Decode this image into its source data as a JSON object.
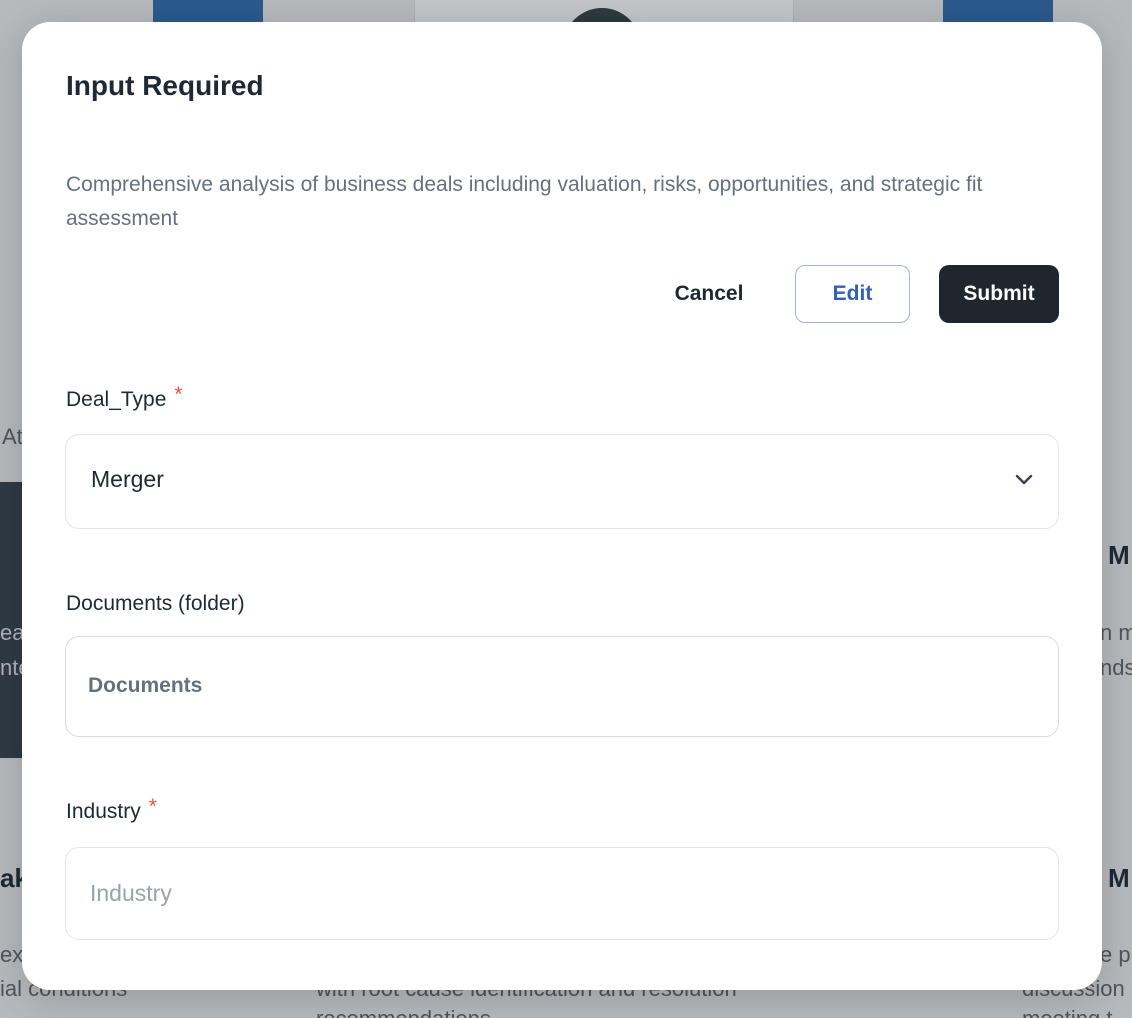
{
  "background": {
    "fragments": [
      "At",
      "M",
      "ea",
      "nte",
      "n m",
      "nds",
      "ak",
      "M",
      "ex",
      "ial conditions",
      "with root cause identification and resolution",
      "recommendations",
      "e p",
      "discussion",
      "meeting t"
    ]
  },
  "modal": {
    "title": "Input Required",
    "description": "Comprehensive analysis of business deals including valuation, risks, opportunities, and strategic fit assessment",
    "buttons": {
      "cancel": "Cancel",
      "edit": "Edit",
      "submit": "Submit"
    },
    "fields": {
      "deal_type": {
        "label": "Deal_Type",
        "required_mark": "*",
        "value": "Merger",
        "icon": "chevron-down-icon"
      },
      "documents": {
        "label": "Documents (folder)",
        "value": "Documents"
      },
      "industry": {
        "label": "Industry",
        "required_mark": "*",
        "value": "",
        "placeholder": "Industry"
      }
    }
  },
  "colors": {
    "primary_dark": "#1f262e",
    "edit_blue": "#2f62b8",
    "required_red": "#e0553f"
  }
}
